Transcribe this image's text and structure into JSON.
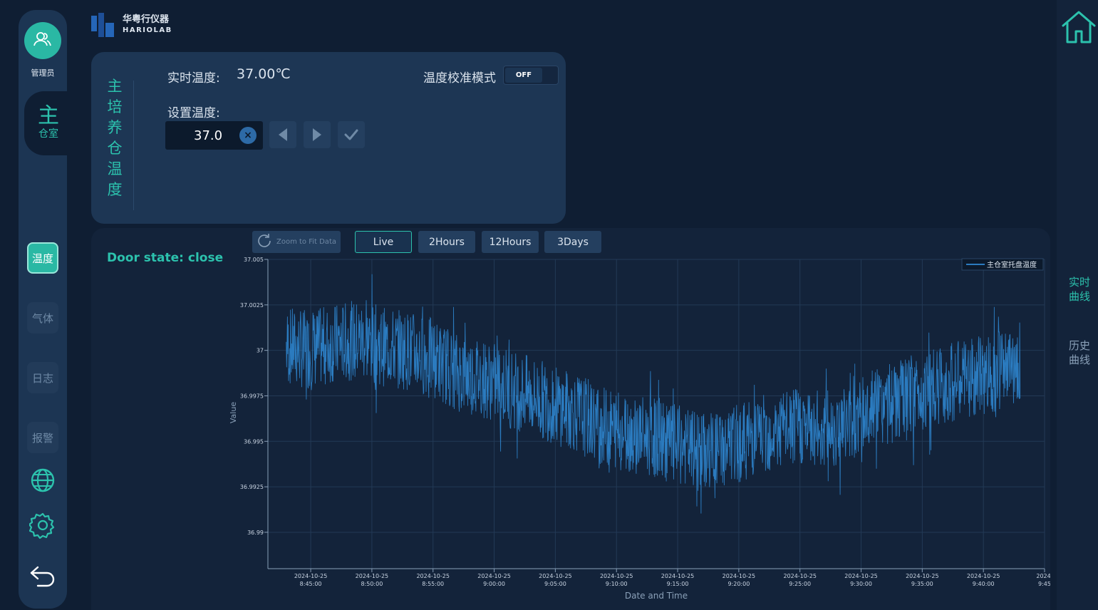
{
  "sidebar": {
    "admin_label": "管理员",
    "chamber_big": "主",
    "chamber_small": "仓室",
    "nav": [
      {
        "label": "温度",
        "active": true
      },
      {
        "label": "气体",
        "active": false
      },
      {
        "label": "日志",
        "active": false
      },
      {
        "label": "报警",
        "active": false
      }
    ],
    "icons": [
      "globe-icon",
      "gear-icon",
      "back-arrow-icon"
    ]
  },
  "logo": {
    "cn": "华粤行仪器",
    "en": "HARIOLAB"
  },
  "control": {
    "title_chars": [
      "主",
      "培",
      "养",
      "仓",
      "温",
      "度"
    ],
    "realtime_label": "实时温度:",
    "realtime_value": "37.00℃",
    "calibration_label": "温度校准模式",
    "calibration_state": "OFF",
    "set_label": "设置温度:",
    "set_value": "37.0"
  },
  "chart_panel": {
    "door_state": "Door state:  close",
    "zoom_label": "Zoom to Fit Data",
    "ranges": [
      {
        "label": "Live",
        "active": true
      },
      {
        "label": "2Hours",
        "active": false
      },
      {
        "label": "12Hours",
        "active": false
      },
      {
        "label": "3Days",
        "active": false
      }
    ]
  },
  "right_rail": {
    "realtime": "实时\n曲线",
    "history": "历史\n曲线"
  },
  "colors": {
    "accent": "#2cc2ad",
    "line": "#2b7bbf",
    "bg": "#0f1e33",
    "panel": "#1d3654"
  },
  "chart_data": {
    "type": "line",
    "xlabel": "Date and Time",
    "ylabel": "Value",
    "ylim": [
      36.988,
      37.005
    ],
    "y_ticks": [
      37.005,
      37.0025,
      37,
      36.9975,
      36.995,
      36.9925,
      36.99
    ],
    "x_ticks": [
      {
        "date": "2024-10-25",
        "time": "8:45:00",
        "min": 0
      },
      {
        "date": "2024-10-25",
        "time": "8:50:00",
        "min": 5
      },
      {
        "date": "2024-10-25",
        "time": "8:55:00",
        "min": 10
      },
      {
        "date": "2024-10-25",
        "time": "9:00:00",
        "min": 15
      },
      {
        "date": "2024-10-25",
        "time": "9:05:00",
        "min": 20
      },
      {
        "date": "2024-10-25",
        "time": "9:10:00",
        "min": 25
      },
      {
        "date": "2024-10-25",
        "time": "9:15:00",
        "min": 30
      },
      {
        "date": "2024-10-25",
        "time": "9:20:00",
        "min": 35
      },
      {
        "date": "2024-10-25",
        "time": "9:25:00",
        "min": 40
      },
      {
        "date": "2024-10-25",
        "time": "9:30:00",
        "min": 45
      },
      {
        "date": "2024-10-25",
        "time": "9:35:00",
        "min": 50
      },
      {
        "date": "2024-10-25",
        "time": "9:40:00",
        "min": 55
      },
      {
        "date": "2024-",
        "time": "9:45",
        "min": 60
      }
    ],
    "xlim": [
      -3.5,
      60
    ],
    "grid": true,
    "legend_position": "top-right",
    "series": [
      {
        "name": "主仓室托盘温度",
        "x_minutes": [
          -2,
          0,
          2,
          4,
          6,
          8,
          10,
          12,
          14,
          16,
          18,
          20,
          22,
          24,
          26,
          28,
          30,
          32,
          34,
          36,
          38,
          40,
          42,
          44,
          46,
          48,
          50,
          52,
          54,
          56,
          58
        ],
        "y": [
          37.0002,
          37.0,
          37.0004,
          37.0006,
          37.0002,
          37.0,
          36.9996,
          36.9988,
          36.9985,
          36.998,
          36.9975,
          36.997,
          36.9965,
          36.9958,
          36.9955,
          36.9952,
          36.9948,
          36.9944,
          36.9946,
          36.9952,
          36.9955,
          36.9958,
          36.9956,
          36.996,
          36.9968,
          36.9972,
          36.9978,
          36.9982,
          36.9985,
          36.9988,
          36.9992
        ],
        "noise_amplitude": 0.0022
      }
    ]
  }
}
